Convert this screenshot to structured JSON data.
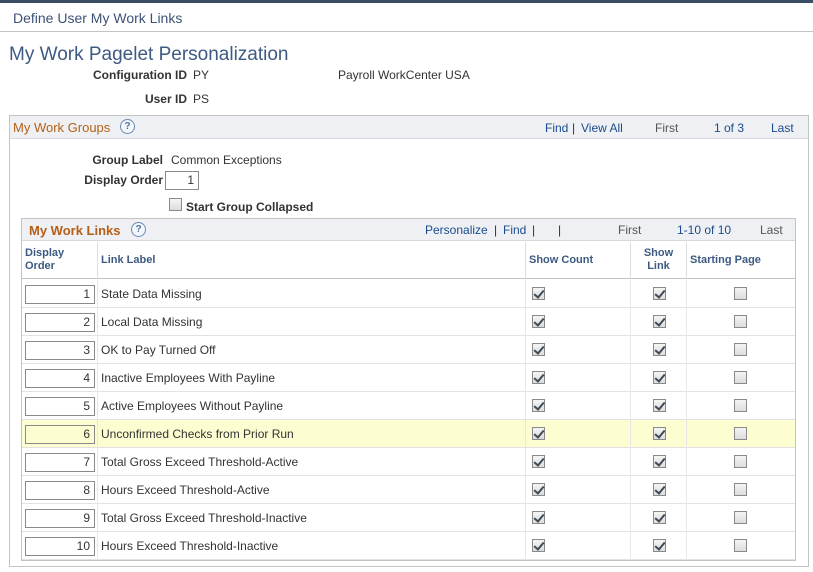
{
  "header": {
    "title": "Define User My Work Links"
  },
  "page": {
    "title": "My Work Pagelet Personalization"
  },
  "config": {
    "config_id_label": "Configuration ID",
    "config_id_value": "PY",
    "config_desc": "Payroll WorkCenter USA",
    "user_id_label": "User ID",
    "user_id_value": "PS"
  },
  "groups": {
    "title": "My Work Groups",
    "help": "?",
    "find": "Find",
    "view_all": "View All",
    "first": "First",
    "position": "1 of 3",
    "last": "Last",
    "separator": "|",
    "group_label_label": "Group Label",
    "group_label_value": "Common Exceptions",
    "display_order_label": "Display Order",
    "display_order_value": "1",
    "collapsed_label": "Start Group Collapsed"
  },
  "links": {
    "title": "My Work Links",
    "help": "?",
    "personalize": "Personalize",
    "find": "Find",
    "separator": "|",
    "first": "First",
    "range": "1-10 of 10",
    "last": "Last",
    "columns": {
      "display_order": "Display Order",
      "link_label": "Link Label",
      "show_count": "Show Count",
      "show_link": "Show Link",
      "starting_page": "Starting Page"
    },
    "rows": [
      {
        "order": "1",
        "label": "State Data Missing"
      },
      {
        "order": "2",
        "label": "Local Data Missing"
      },
      {
        "order": "3",
        "label": "OK to Pay Turned Off"
      },
      {
        "order": "4",
        "label": "Inactive Employees With Payline"
      },
      {
        "order": "5",
        "label": "Active Employees Without Payline"
      },
      {
        "order": "6",
        "label": "Unconfirmed Checks from Prior Run"
      },
      {
        "order": "7",
        "label": "Total Gross Exceed Threshold-Active"
      },
      {
        "order": "8",
        "label": "Hours Exceed Threshold-Active"
      },
      {
        "order": "9",
        "label": "Total Gross Exceed Threshold-Inactive"
      },
      {
        "order": "10",
        "label": "Hours Exceed Threshold-Inactive"
      }
    ]
  },
  "colors": {
    "accent_orange": "#b45f17",
    "title_blue": "#3d5a82",
    "link_blue": "#1a4b8e",
    "highlight_row": "#fdfdd2"
  }
}
